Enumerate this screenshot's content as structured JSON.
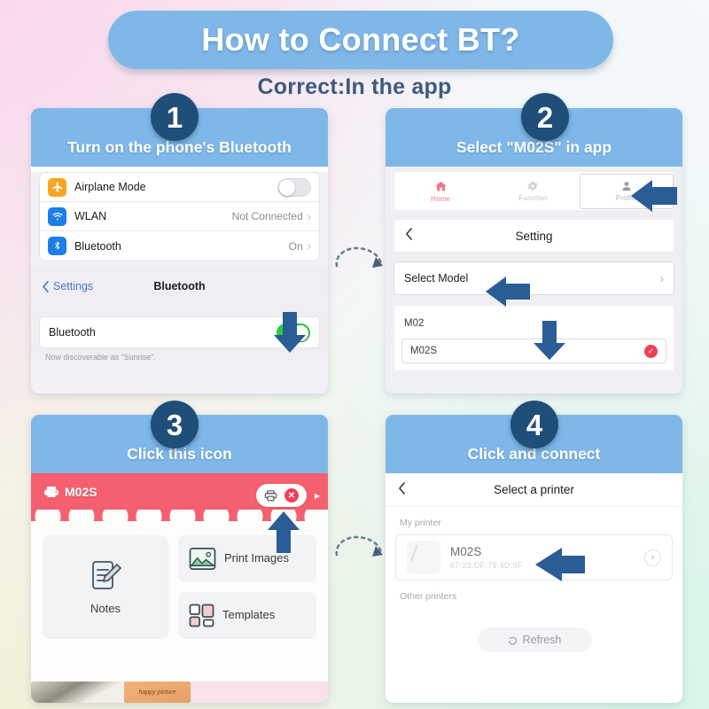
{
  "header": {
    "title": "How to Connect BT?",
    "subtitle": "Correct:In the app"
  },
  "colors": {
    "header_blue": "#7fb8e8",
    "badge_navy": "#1f4e79",
    "arrow_blue": "#2a5c96",
    "banner_red": "#f4606f",
    "toggle_green": "#2ecb3f",
    "accent_red": "#ef4056"
  },
  "panels": [
    {
      "step": "1",
      "heading": "Turn on the phone's Bluetooth",
      "settings_rows": [
        {
          "icon": "airplane-icon",
          "label": "Airplane Mode",
          "value": "",
          "control": "toggle-off"
        },
        {
          "icon": "wifi-icon",
          "label": "WLAN",
          "value": "Not Connected",
          "control": "chevron"
        },
        {
          "icon": "bluetooth-icon",
          "label": "Bluetooth",
          "value": "On",
          "control": "chevron"
        }
      ],
      "bt_nav": {
        "back": "Settings",
        "title": "Bluetooth"
      },
      "bt_toggle": {
        "label": "Bluetooth",
        "state": "on"
      },
      "bt_footer": "Now discoverable as \"Sunrise\"."
    },
    {
      "step": "2",
      "heading": "Select \"M02S\" in app",
      "tabs": [
        {
          "label": "Home",
          "icon": "home-icon"
        },
        {
          "label": "Function",
          "icon": "gear-icon"
        },
        {
          "label": "Profile",
          "icon": "person-icon"
        }
      ],
      "nav": {
        "back": "‹",
        "title": "Setting"
      },
      "select_model": {
        "label": "Select Model",
        "chevron": "›"
      },
      "models": [
        {
          "name": "M02",
          "selected": false
        },
        {
          "name": "M02S",
          "selected": true
        }
      ]
    },
    {
      "step": "3",
      "heading": "Click this icon",
      "device_name": "M02S",
      "banner_buttons": [
        {
          "name": "printer-icon"
        },
        {
          "name": "close-icon",
          "glyph": "✕"
        }
      ],
      "tiles": [
        {
          "label": "Notes",
          "icon": "notes-icon"
        },
        {
          "label": "Print Images",
          "icon": "image-icon"
        },
        {
          "label": "Templates",
          "icon": "templates-icon"
        }
      ],
      "photo_strip_caption": "happy picture"
    },
    {
      "step": "4",
      "heading": "Click and connect",
      "nav": {
        "back": "‹",
        "title": "Select a printer"
      },
      "my_printer_label": "My printer",
      "printer": {
        "name": "M02S",
        "mac": "67:23:DF:79:4D:9F",
        "chevron": "›"
      },
      "other_printers_label": "Other printers",
      "refresh_label": "Refresh"
    }
  ]
}
